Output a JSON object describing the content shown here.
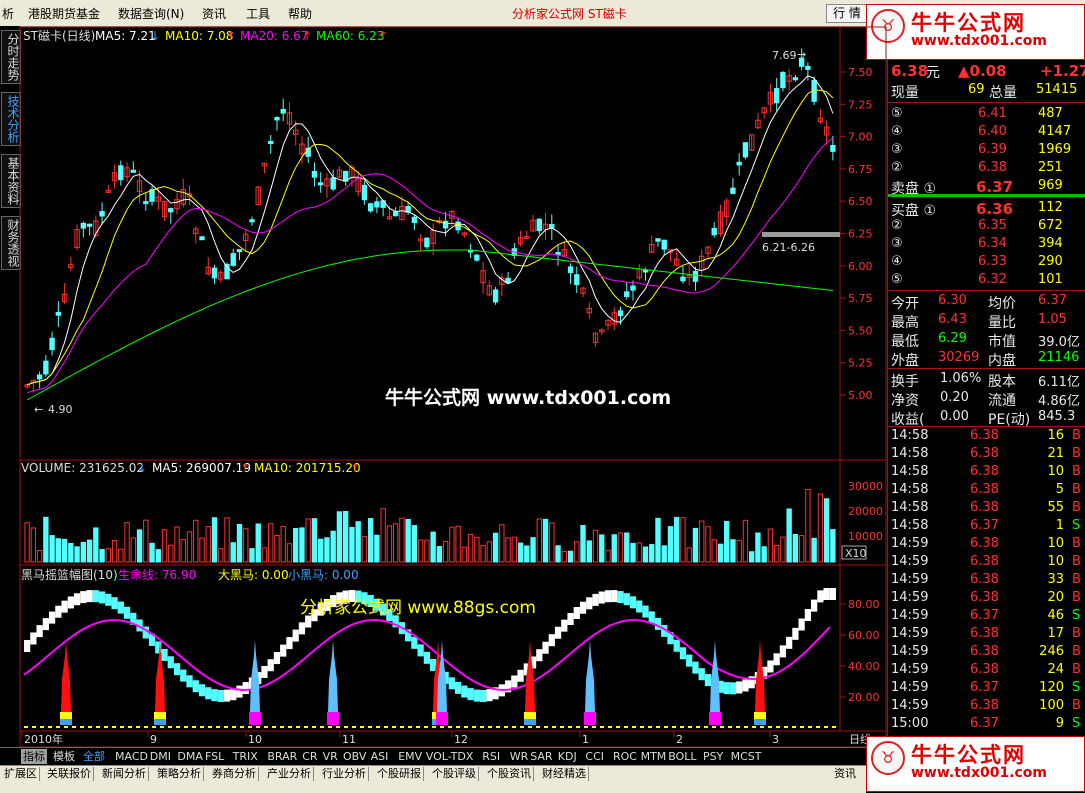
{
  "menu": {
    "items": [
      "析",
      "港股期货基金",
      "数据查询(N)",
      "资讯",
      "工具",
      "帮助"
    ],
    "title": "分析家公式网 ST磁卡",
    "right_button": "行 情"
  },
  "logo": {
    "name": "牛牛公式网",
    "url": "www.tdx001.com"
  },
  "left_tabs": [
    "分时走势",
    "技术分析",
    "基本资料",
    "财务透视"
  ],
  "price_chart": {
    "label": "ST磁卡(日线)",
    "ma5": "MA5: 7.21",
    "ma10": "MA10: 7.08",
    "ma20": "MA20: 6.67",
    "ma60": "MA60: 6.23",
    "y_ticks": [
      "7.50",
      "7.25",
      "7.00",
      "6.75",
      "6.50",
      "6.25",
      "6.00",
      "5.75",
      "5.50",
      "5.25",
      "5.00"
    ],
    "high_label": "7.69",
    "low_label": "4.90",
    "range_label": "6.21-6.26",
    "watermark": "牛牛公式网 www.tdx001.com"
  },
  "volume_chart": {
    "label": "VOLUME: 231625.02",
    "ma5": "MA5: 269007.19",
    "ma10": "MA10: 201715.20",
    "y_ticks": [
      "30000",
      "20000",
      "10000"
    ],
    "unit": "X10"
  },
  "indicator_chart": {
    "label": "黑马摇篮幅图(10)",
    "life": "生命线: 76.90",
    "big_horse": "大黑马: 0.00",
    "small_horse": "小黑马: 0.00",
    "y_ticks": [
      "80.00",
      "60.00",
      "40.00",
      "20.00"
    ],
    "watermark": "分析家公式网 www.88gs.com"
  },
  "x_axis": {
    "labels": [
      "2010年",
      "9",
      "10",
      "11",
      "12",
      "1",
      "2",
      "3"
    ],
    "right": "日线"
  },
  "quote": {
    "price": "6.38",
    "price_unit": "元",
    "change": "▲0.08",
    "change_pct": "+1.27",
    "volume_label": "现量",
    "volume": "69",
    "total_label": "总量",
    "total": "51415",
    "asks": [
      {
        "lvl": "⑤",
        "price": "6.41",
        "qty": "487"
      },
      {
        "lvl": "④",
        "price": "6.40",
        "qty": "4147"
      },
      {
        "lvl": "③",
        "price": "6.39",
        "qty": "1969"
      },
      {
        "lvl": "②",
        "price": "6.38",
        "qty": "251"
      },
      {
        "lvl": "卖盘 ①",
        "price": "6.37",
        "qty": "969"
      }
    ],
    "bids": [
      {
        "lvl": "买盘 ①",
        "price": "6.36",
        "qty": "112"
      },
      {
        "lvl": "②",
        "price": "6.35",
        "qty": "672"
      },
      {
        "lvl": "③",
        "price": "6.34",
        "qty": "394"
      },
      {
        "lvl": "④",
        "price": "6.33",
        "qty": "290"
      },
      {
        "lvl": "⑤",
        "price": "6.32",
        "qty": "101"
      }
    ],
    "stats": [
      {
        "l1": "今开",
        "v1": "6.30",
        "c1": "red",
        "l2": "均价",
        "v2": "6.37",
        "c2": "red"
      },
      {
        "l1": "最高",
        "v1": "6.43",
        "c1": "red",
        "l2": "量比",
        "v2": "1.05",
        "c2": "red"
      },
      {
        "l1": "最低",
        "v1": "6.29",
        "c1": "grn",
        "l2": "市值",
        "v2": "39.0亿",
        "c2": "wht"
      },
      {
        "l1": "外盘",
        "v1": "30269",
        "c1": "red",
        "l2": "内盘",
        "v2": "21146",
        "c2": "grn"
      }
    ],
    "stats2": [
      {
        "l1": "换手",
        "v1": "1.06%",
        "l2": "股本",
        "v2": "6.11亿"
      },
      {
        "l1": "净资",
        "v1": "0.20",
        "l2": "流通",
        "v2": "4.86亿"
      },
      {
        "l1": "收益(",
        "v1": "0.00",
        "l2": "PE(动)",
        "v2": "845.3"
      }
    ],
    "ticks": [
      {
        "t": "14:58",
        "p": "6.38",
        "q": "16",
        "s": "B"
      },
      {
        "t": "14:58",
        "p": "6.38",
        "q": "21",
        "s": "B"
      },
      {
        "t": "14:58",
        "p": "6.38",
        "q": "10",
        "s": "B"
      },
      {
        "t": "14:58",
        "p": "6.38",
        "q": "5",
        "s": "B"
      },
      {
        "t": "14:58",
        "p": "6.38",
        "q": "55",
        "s": "B"
      },
      {
        "t": "14:58",
        "p": "6.37",
        "q": "1",
        "s": "S"
      },
      {
        "t": "14:59",
        "p": "6.38",
        "q": "10",
        "s": "B"
      },
      {
        "t": "14:59",
        "p": "6.38",
        "q": "10",
        "s": "B"
      },
      {
        "t": "14:59",
        "p": "6.38",
        "q": "33",
        "s": "B"
      },
      {
        "t": "14:59",
        "p": "6.38",
        "q": "20",
        "s": "B"
      },
      {
        "t": "14:59",
        "p": "6.37",
        "q": "46",
        "s": "S"
      },
      {
        "t": "14:59",
        "p": "6.38",
        "q": "17",
        "s": "B"
      },
      {
        "t": "14:59",
        "p": "6.38",
        "q": "246",
        "s": "B"
      },
      {
        "t": "14:59",
        "p": "6.38",
        "q": "24",
        "s": "B"
      },
      {
        "t": "14:59",
        "p": "6.37",
        "q": "120",
        "s": "S"
      },
      {
        "t": "14:59",
        "p": "6.38",
        "q": "100",
        "s": "B"
      },
      {
        "t": "15:00",
        "p": "6.37",
        "q": "9",
        "s": "S"
      }
    ]
  },
  "bottom_tabs": [
    "指标",
    "模板",
    "全部",
    "MACD",
    "DMI",
    "DMA",
    "FSL",
    "TRIX",
    "BRAR",
    "CR",
    "VR",
    "OBV",
    "ASI",
    "EMV",
    "VOL-TDX",
    "RSI",
    "WR",
    "SAR",
    "KDJ",
    "CCI",
    "ROC",
    "MTM",
    "BOLL",
    "PSY",
    "MCST"
  ],
  "status_tabs": [
    "扩展区",
    "关联报价",
    "新闻分析",
    "策略分析",
    "券商分析",
    "产业分析",
    "行业分析",
    "个股研报",
    "个股评级",
    "个股资讯",
    "财经精选"
  ],
  "status_right": "资讯",
  "colors": {
    "up": "#ff3030",
    "down": "#54ffff",
    "ma5": "#ffffff",
    "ma10": "#ffff00",
    "ma20": "#ff00ff",
    "ma60": "#00ff00",
    "life": "#ff00ff"
  }
}
